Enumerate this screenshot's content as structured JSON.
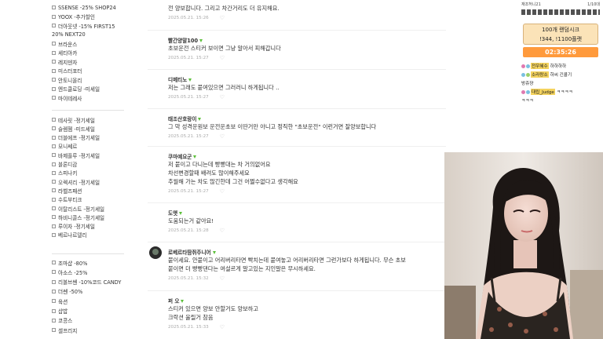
{
  "sidebar": {
    "items_top": [
      {
        "label": "SSENSE -25% SHOP24",
        "checkbox": true
      },
      {
        "label": "YOOX -추가할인",
        "checkbox": true
      },
      {
        "label": "더아웃넷 -15% FIRST15",
        "checkbox": true
      },
      {
        "label": "20% NEXT20",
        "checkbox": false
      },
      {
        "label": "브라운스",
        "checkbox": true
      },
      {
        "label": "세티아카",
        "checkbox": true
      },
      {
        "label": "레지덴자",
        "checkbox": true
      },
      {
        "label": "미스터포터",
        "checkbox": true
      },
      {
        "label": "안토니올리",
        "checkbox": true
      },
      {
        "label": "엔드클로딩 -미세일",
        "checkbox": true
      },
      {
        "label": "마이테레사",
        "checkbox": true
      }
    ],
    "items_mid": [
      {
        "label": "테사릿 -정기세일"
      },
      {
        "label": "슬렘젬 -미드세일"
      },
      {
        "label": "더블에프 -정기세일"
      },
      {
        "label": "모니쎄르"
      },
      {
        "label": "바제플루 -정기세일"
      },
      {
        "label": "블론디감"
      },
      {
        "label": "스피나키"
      },
      {
        "label": "오렉셔리 -정기세일"
      },
      {
        "label": "라벨즈패션"
      },
      {
        "label": "수트부티크"
      },
      {
        "label": "이탈리스트 -정기세일"
      },
      {
        "label": "하비니콜스 -정기세일"
      },
      {
        "label": "루이자 -정기세일"
      },
      {
        "label": "베르나르델리"
      }
    ],
    "items_bottom": [
      {
        "label": "조마샵 -80%"
      },
      {
        "label": "아소스 -25%"
      },
      {
        "label": "리볼브쎈 -10%코드 CANDY"
      },
      {
        "label": "더쎈 -50%"
      },
      {
        "label": "육션"
      },
      {
        "label": "샵밥"
      },
      {
        "label": "코콩스"
      },
      {
        "label": "셀프리지"
      }
    ]
  },
  "comments": [
    {
      "name": "",
      "lines": [
        "전 양보합니다. 그리고 차간거리도 더 유지해요."
      ],
      "date": "2025.05.21. 15:26"
    },
    {
      "name": "빨간양말100",
      "lines": [
        "초보운전 스티커 보이면 그냥 알아서 피해갑니다"
      ],
      "date": "2025.05.21. 15:27"
    },
    {
      "name": "디메티노",
      "lines": [
        "저는 그래도 붙여있으면 그러러니 하게됩니다 .."
      ],
      "date": "2025.05.21. 15:27"
    },
    {
      "name": "태조산호랑이",
      "lines": [
        "그 막 성격운원보 운전운초보 이딴거만 아니고 정직한 \"초보운전\" 이런거면 잘양보합니다"
      ],
      "date": "2025.05.21. 15:27"
    },
    {
      "name": "쿠마예요군",
      "lines": [
        "저 붙이고 다니는데 빵빵대는 차 거의없어요",
        "차선변경할때 배려도 많이해주세요",
        "추월해 가는 차도 많긴한데 그건 어쩔수없다고 생각해요"
      ],
      "date": "2025.05.21. 15:27"
    },
    {
      "name": "도앳",
      "lines": [
        "도움되는거 같아요!"
      ],
      "date": "2025.05.21. 15:28"
    },
    {
      "name": "로베르타땀쥐주니어",
      "lines": [
        "붙이세요. 안붙이고 어리버리타면 빡치는데 붙여놓고 어리버리타면 그런가보다 하게됩니다. 무슨 초보",
        "붙이면 더 빵빵댄다는 여설르게 말고있는 지인말은 무시하세요."
      ],
      "date": "2025.05.21. 15:32"
    },
    {
      "name": "퍼 오",
      "lines": [
        "스티커 있으면 양보 안할거도 양보하고",
        "크락션 울릴거 참음"
      ],
      "date": "2025.05.21. 15:33"
    }
  ],
  "overlay": {
    "top_left": "재조허니21",
    "top_right": "1/10대",
    "box_line1": "100개 랜덤시크",
    "box_line2": "!344, !1100플랫",
    "timer": "02:35:26",
    "chats": [
      {
        "name": "전우혜수",
        "text": "하하하하"
      },
      {
        "name": "소라랑소",
        "text": "하씨 긴콜기"
      },
      {
        "name": "",
        "text": "방쥬쟝"
      },
      {
        "name": "대립_Judge",
        "text": "ㅋㅋㅋㅋ"
      },
      {
        "name": "",
        "text": "ㅋㅋㅋ"
      }
    ]
  },
  "colors": {
    "badge": "#5cbf3a",
    "timer_bg": "#ff9a3c",
    "box_bg": "#fbe3b8"
  }
}
